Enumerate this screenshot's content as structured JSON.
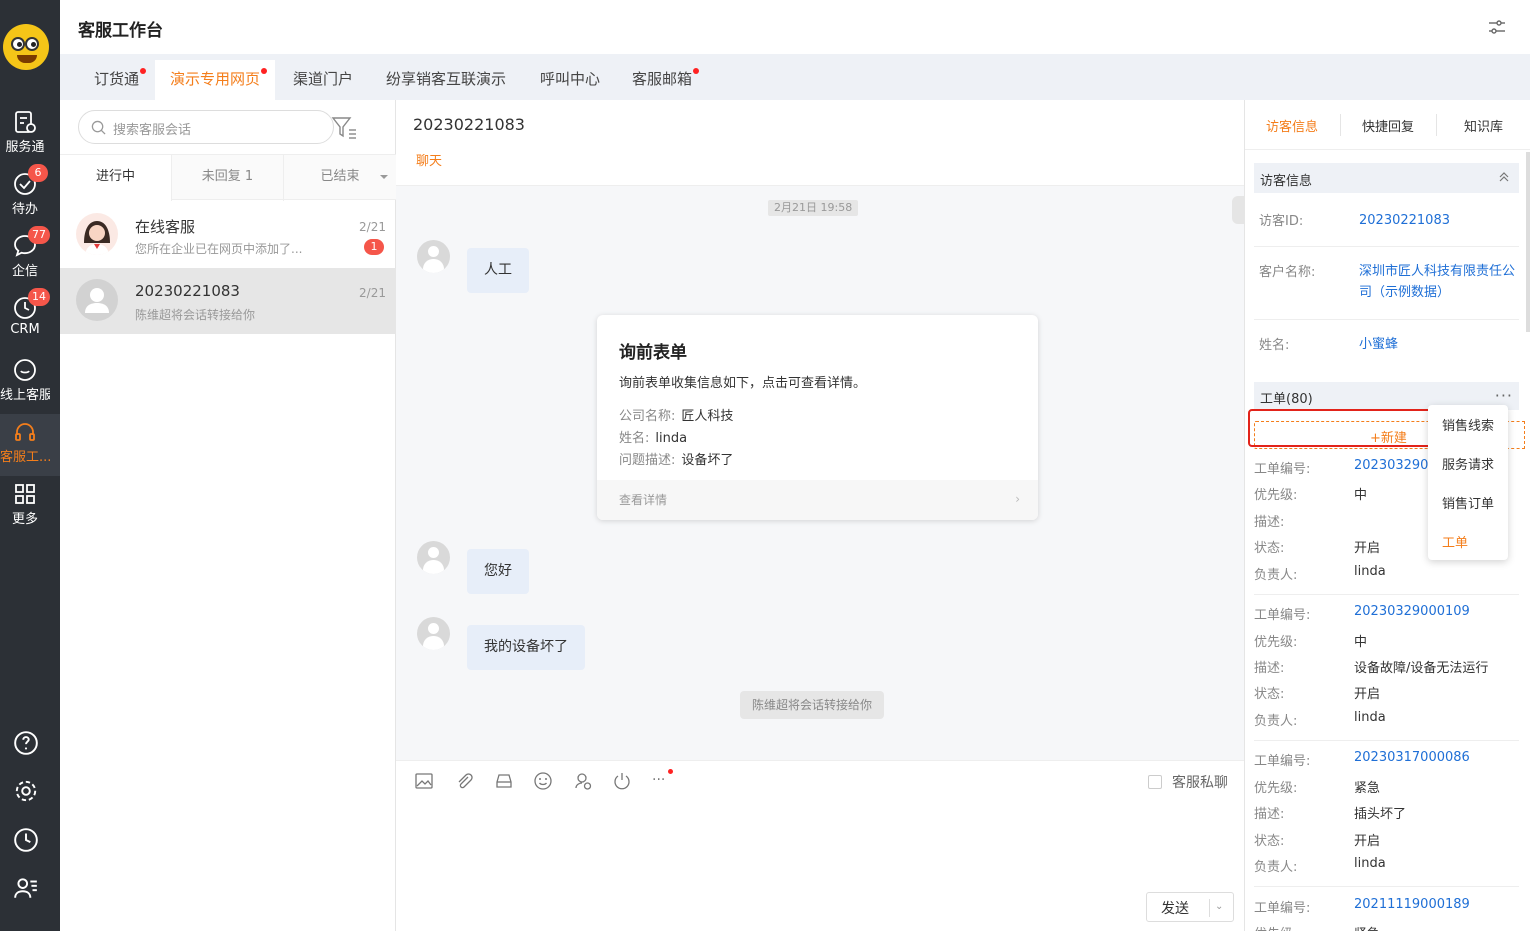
{
  "app": {
    "title": "客服工作台"
  },
  "rail": {
    "items": [
      {
        "label": "服务通",
        "badge": ""
      },
      {
        "label": "待办",
        "badge": "6"
      },
      {
        "label": "企信",
        "badge": "77"
      },
      {
        "label": "CRM",
        "badge": "14"
      },
      {
        "label": "线上客服",
        "badge": ""
      },
      {
        "label": "客服工...",
        "badge": ""
      },
      {
        "label": "更多",
        "badge": ""
      }
    ]
  },
  "tabs": [
    {
      "label": "订货通",
      "dot": true
    },
    {
      "label": "演示专用网页",
      "dot": true,
      "active": true
    },
    {
      "label": "渠道门户",
      "dot": false
    },
    {
      "label": "纷享销客互联演示",
      "dot": false
    },
    {
      "label": "呼叫中心",
      "dot": false
    },
    {
      "label": "客服邮箱",
      "dot": true
    }
  ],
  "sessions": {
    "search_placeholder": "搜索客服会话",
    "tabs": [
      "进行中",
      "未回复 1",
      "已结束"
    ],
    "items": [
      {
        "name": "在线客服",
        "preview": "您所在企业已在网页中添加了...",
        "time": "2/21",
        "badge": "1"
      },
      {
        "name": "20230221083",
        "preview": "陈维超将会话转接给你",
        "time": "2/21",
        "badge": ""
      }
    ]
  },
  "chat": {
    "title": "20230221083",
    "subtab": "聊天",
    "time_chip": "2月21日 19:58",
    "messages": [
      "人工",
      "您好",
      "我的设备坏了"
    ],
    "form": {
      "title": "询前表单",
      "desc": "询前表单收集信息如下，点击可查看详情。",
      "rows": [
        {
          "k": "公司名称:",
          "v": "匠人科技"
        },
        {
          "k": "姓名:",
          "v": "linda"
        },
        {
          "k": "问题描述:",
          "v": "设备坏了"
        }
      ],
      "footer": "查看详情"
    },
    "system_note": "陈维超将会话转接给你",
    "private_label": "客服私聊",
    "send_label": "发送"
  },
  "right": {
    "tabs": [
      "访客信息",
      "快捷回复",
      "知识库"
    ],
    "visitor_section": "访客信息",
    "visitor": [
      {
        "k": "访客ID:",
        "v": "20230221083"
      },
      {
        "k": "客户名称:",
        "v": "深圳市匠人科技有限责任公司（示例数据）"
      },
      {
        "k": "姓名:",
        "v": "小蜜蜂"
      }
    ],
    "ticket_section": "工单(80)",
    "new_label": "+新建",
    "dropdown": [
      "销售线索",
      "服务请求",
      "销售订单",
      "工单"
    ],
    "ticket_labels": {
      "no": "工单编号:",
      "priority": "优先级:",
      "desc": "描述:",
      "status": "状态:",
      "owner": "负责人:"
    },
    "tickets": [
      {
        "no": "2023032900",
        "priority": "中",
        "desc": "",
        "status": "开启",
        "owner": "linda"
      },
      {
        "no": "20230329000109",
        "priority": "中",
        "desc": "设备故障/设备无法运行",
        "status": "开启",
        "owner": "linda"
      },
      {
        "no": "20230317000086",
        "priority": "紧急",
        "desc": "插头坏了",
        "status": "开启",
        "owner": "linda"
      },
      {
        "no": "20211119000189",
        "priority": "紧急",
        "desc": "",
        "status": "",
        "owner": ""
      }
    ]
  }
}
